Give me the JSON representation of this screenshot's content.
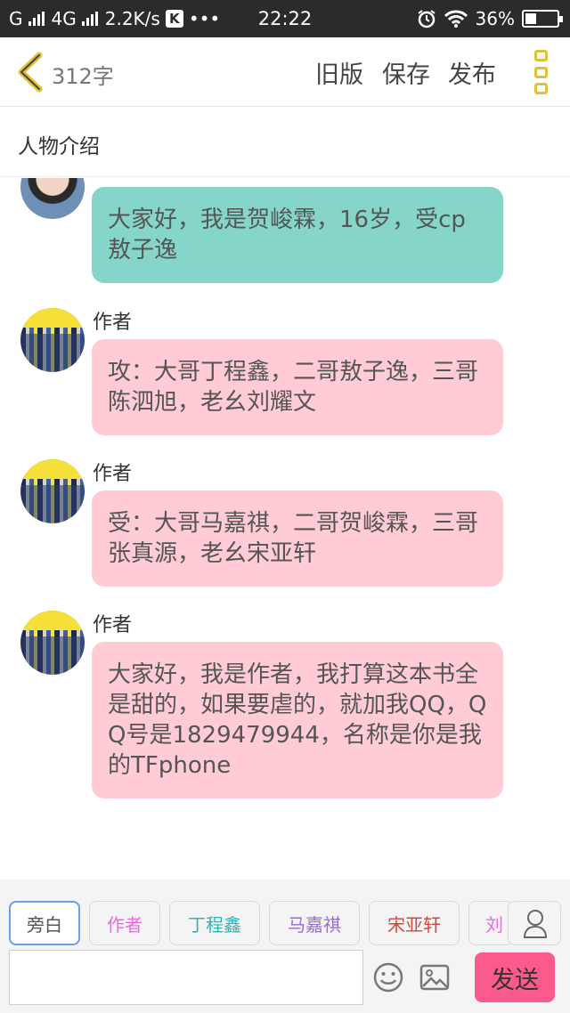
{
  "status_bar": {
    "network_label": "G",
    "network_type": "4G",
    "speed": "2.2K/s",
    "app_badge": "K",
    "more": "•••",
    "time": "22:22",
    "battery": "36%",
    "battery_level": 0.36
  },
  "header": {
    "word_count": "312字",
    "old_version_label": "旧版",
    "save_label": "保存",
    "publish_label": "发布"
  },
  "section": {
    "title": "人物介绍"
  },
  "messages": [
    {
      "sender": "",
      "avatar": "boy-avatar",
      "bubble_color": "#85d6c8",
      "text": "大家好，我是贺峻霖，16岁，受cp敖子逸"
    },
    {
      "sender": "作者",
      "avatar": "group-avatar",
      "bubble_color": "#ffccd6",
      "text": "攻：大哥丁程鑫，二哥敖子逸，三哥陈泗旭，老幺刘耀文"
    },
    {
      "sender": "作者",
      "avatar": "group-avatar",
      "bubble_color": "#ffccd6",
      "text": "受：大哥马嘉祺，二哥贺峻霖，三哥张真源，老幺宋亚轩"
    },
    {
      "sender": "作者",
      "avatar": "group-avatar",
      "bubble_color": "#ffccd6",
      "text": "大家好，我是作者，我打算这本书全是甜的，如果要虐的，就加我QQ，QQ号是1829479944，名称是你是我的TFphone"
    }
  ],
  "roles": [
    {
      "label": "旁白",
      "color": "#555555",
      "selected": true
    },
    {
      "label": "作者",
      "color": "#e26ee0",
      "selected": false
    },
    {
      "label": "丁程鑫",
      "color": "#2fb4b4",
      "selected": false
    },
    {
      "label": "马嘉祺",
      "color": "#9b6ad8",
      "selected": false
    },
    {
      "label": "宋亚轩",
      "color": "#d0483b",
      "selected": false
    },
    {
      "label": "刘",
      "color": "#e26ee0",
      "selected": false
    }
  ],
  "input": {
    "value": "",
    "placeholder": ""
  },
  "send_label": "发送",
  "colors": {
    "accent_yellow": "#e0c23a",
    "send_pink": "#fb5a8c"
  }
}
